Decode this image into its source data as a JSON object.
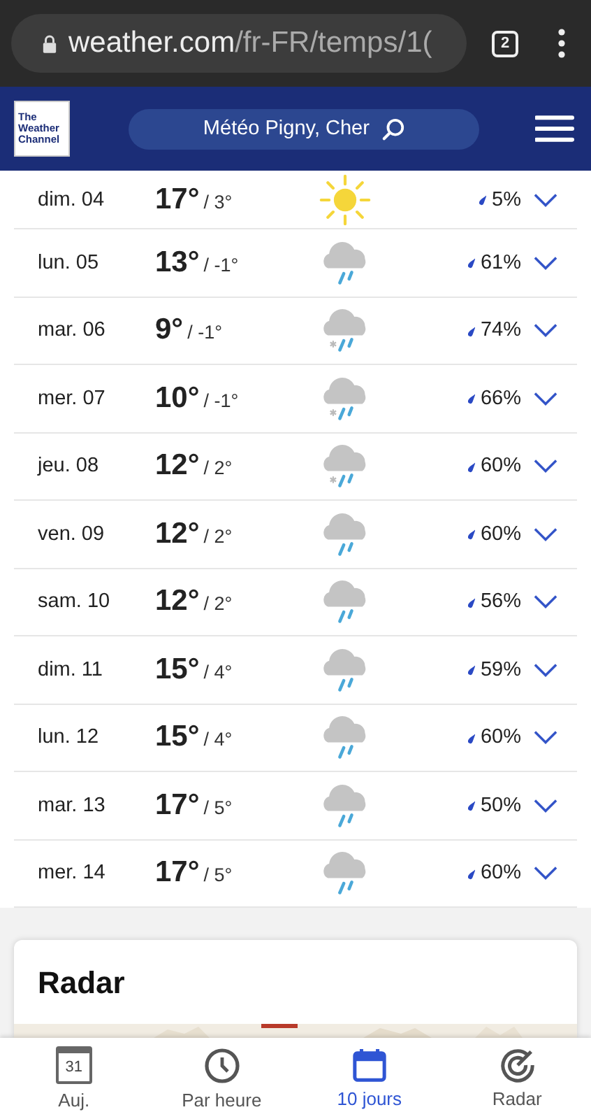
{
  "browser": {
    "url_host": "weather.com",
    "url_path": "/fr-FR/temps/1(",
    "tab_count": "2"
  },
  "header": {
    "logo": [
      "The",
      "Weather",
      "Channel"
    ],
    "search": "Météo Pigny, Cher"
  },
  "days": [
    {
      "day": "dim. 04",
      "high": "17°",
      "low": "/ 3°",
      "kind": "sun",
      "precip": "5%"
    },
    {
      "day": "lun. 05",
      "high": "13°",
      "low": "/ -1°",
      "kind": "rain",
      "precip": "61%"
    },
    {
      "day": "mar. 06",
      "high": "9°",
      "low": "/ -1°",
      "kind": "mix",
      "precip": "74%"
    },
    {
      "day": "mer. 07",
      "high": "10°",
      "low": "/ -1°",
      "kind": "mix",
      "precip": "66%"
    },
    {
      "day": "jeu. 08",
      "high": "12°",
      "low": "/ 2°",
      "kind": "mix",
      "precip": "60%"
    },
    {
      "day": "ven. 09",
      "high": "12°",
      "low": "/ 2°",
      "kind": "rain",
      "precip": "60%"
    },
    {
      "day": "sam. 10",
      "high": "12°",
      "low": "/ 2°",
      "kind": "rain",
      "precip": "56%"
    },
    {
      "day": "dim. 11",
      "high": "15°",
      "low": "/ 4°",
      "kind": "rain",
      "precip": "59%"
    },
    {
      "day": "lun. 12",
      "high": "15°",
      "low": "/ 4°",
      "kind": "rain",
      "precip": "60%"
    },
    {
      "day": "mar. 13",
      "high": "17°",
      "low": "/ 5°",
      "kind": "rain",
      "precip": "50%"
    },
    {
      "day": "mer. 14",
      "high": "17°",
      "low": "/ 5°",
      "kind": "rain",
      "precip": "60%"
    }
  ],
  "radar": {
    "title": "Radar"
  },
  "nav": [
    {
      "label": "Auj.",
      "kind": "today",
      "icon_text": "31",
      "selected": false
    },
    {
      "label": "Par heure",
      "kind": "hourly",
      "selected": false
    },
    {
      "label": "10 jours",
      "kind": "tenday",
      "selected": true
    },
    {
      "label": "Radar",
      "kind": "radar",
      "selected": false
    }
  ]
}
